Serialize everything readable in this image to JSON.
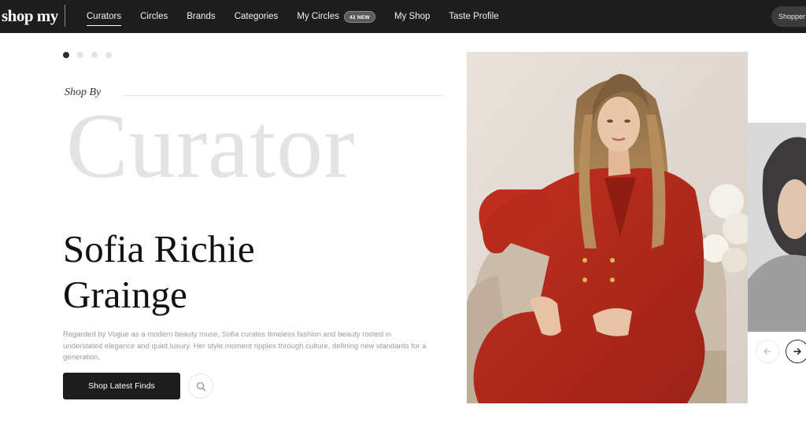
{
  "brand": {
    "logo_text": "shop my"
  },
  "nav": {
    "links": [
      {
        "label": "Curators"
      },
      {
        "label": "Circles"
      },
      {
        "label": "Brands"
      },
      {
        "label": "Categories"
      },
      {
        "label": "My Circles"
      },
      {
        "label": "My Shop"
      },
      {
        "label": "Taste Profile"
      }
    ],
    "active_index": 0,
    "my_circles_badge": "42 NEW",
    "account_pill": "Shopper"
  },
  "hero": {
    "carousel_dots": {
      "count": 4,
      "active_index": 0
    },
    "eyebrow": "Shop By",
    "big_word": "Curator",
    "name_line1": "Sofia Richie",
    "name_line2": "Grainge",
    "description": "Regarded by Vogue as a modern beauty muse, Sofia curates timeless fashion and beauty rooted in understated elegance and quiet luxury. Her style moment ripples through culture, defining new standards for a generation.",
    "cta_label": "Shop Latest Finds"
  },
  "icons": {
    "search": "search-icon",
    "prev": "arrow-left-icon",
    "next": "arrow-right-icon"
  },
  "colors": {
    "nav_bg": "#1d1d1d",
    "cta_bg": "#1d1d1d",
    "suit_red": "#b8281c",
    "ghost_text": "#e3e3e3"
  }
}
